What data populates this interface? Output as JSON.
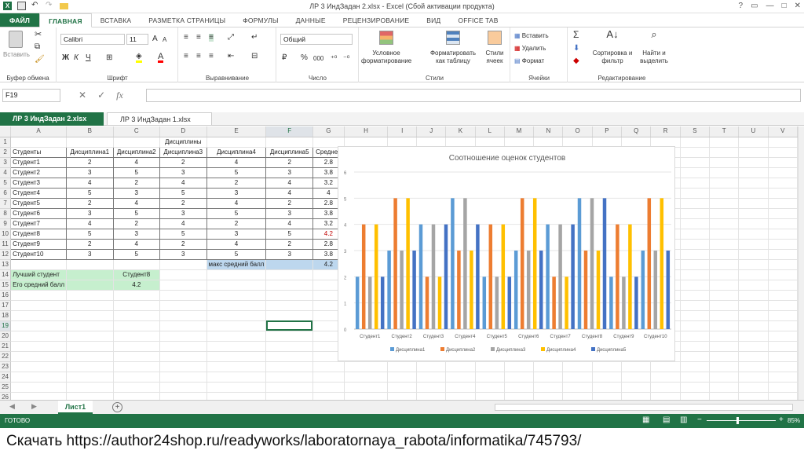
{
  "window": {
    "title": "ЛР 3 ИндЗадан 2.xlsx - Excel (Сбой активации продукта)",
    "excel_logo": "X"
  },
  "tabs": [
    "ФАЙЛ",
    "ГЛАВНАЯ",
    "ВСТАВКА",
    "РАЗМЕТКА СТРАНИЦЫ",
    "ФОРМУЛЫ",
    "ДАННЫЕ",
    "РЕЦЕНЗИРОВАНИЕ",
    "ВИД",
    "OFFICE TAB"
  ],
  "ribbon": {
    "clipboard": {
      "paste": "Вставить",
      "label": "Буфер обмена"
    },
    "font": {
      "name": "Calibri",
      "size": "11",
      "bold": "Ж",
      "italic": "К",
      "underline": "Ч",
      "label": "Шрифт",
      "grow": "A",
      "shrink": "A",
      "color_a": "A"
    },
    "align": {
      "label": "Выравнивание"
    },
    "number": {
      "format": "Общий",
      "percent": "%",
      "thousands": "000",
      "label": "Число"
    },
    "styles": {
      "conditional": "Условное форматирование",
      "format_table": "Форматировать как таблицу",
      "cell_styles": "Стили ячеек",
      "label": "Стили"
    },
    "cells": {
      "insert": "Вставить",
      "delete": "Удалить",
      "format": "Формат",
      "label": "Ячейки"
    },
    "editing": {
      "sort": "Сортировка и фильтр",
      "find": "Найти и выделить",
      "label": "Редактирование",
      "sigma": "Σ"
    }
  },
  "formula": {
    "namebox": "F19",
    "fx": "fx",
    "value": ""
  },
  "workbook_tabs": [
    {
      "label": "ЛР 3 ИндЗадан 2.xlsx",
      "active": true
    },
    {
      "label": "ЛР 3 ИндЗадан 1.xlsx",
      "active": false
    }
  ],
  "columns": [
    "A",
    "B",
    "C",
    "D",
    "E",
    "F",
    "G",
    "H",
    "I",
    "J",
    "K",
    "L",
    "M",
    "N",
    "O",
    "P",
    "Q",
    "R",
    "S",
    "T",
    "U",
    "V"
  ],
  "rows": [
    {
      "n": "1",
      "cells": [
        "",
        "",
        "",
        "Дисциплины",
        "",
        "",
        "",
        ""
      ]
    },
    {
      "n": "2",
      "cells": [
        "Студенты",
        "Дисциплина1",
        "Дисциплина2",
        "Дисциплина3",
        "Дисциплина4",
        "Дисциплина5",
        "Среднее"
      ]
    },
    {
      "n": "3",
      "cells": [
        "Студент1",
        "2",
        "4",
        "2",
        "4",
        "2",
        "2.8"
      ]
    },
    {
      "n": "4",
      "cells": [
        "Студент2",
        "3",
        "5",
        "3",
        "5",
        "3",
        "3.8"
      ]
    },
    {
      "n": "5",
      "cells": [
        "Студент3",
        "4",
        "2",
        "4",
        "2",
        "4",
        "3.2"
      ]
    },
    {
      "n": "6",
      "cells": [
        "Студент4",
        "5",
        "3",
        "5",
        "3",
        "4",
        "4"
      ]
    },
    {
      "n": "7",
      "cells": [
        "Студент5",
        "2",
        "4",
        "2",
        "4",
        "2",
        "2.8"
      ]
    },
    {
      "n": "8",
      "cells": [
        "Студент6",
        "3",
        "5",
        "3",
        "5",
        "3",
        "3.8"
      ]
    },
    {
      "n": "9",
      "cells": [
        "Студент7",
        "4",
        "2",
        "4",
        "2",
        "4",
        "3.2"
      ]
    },
    {
      "n": "10",
      "cells": [
        "Студент8",
        "5",
        "3",
        "5",
        "3",
        "5",
        "4.2"
      ]
    },
    {
      "n": "11",
      "cells": [
        "Студент9",
        "2",
        "4",
        "2",
        "4",
        "2",
        "2.8"
      ]
    },
    {
      "n": "12",
      "cells": [
        "Студент10",
        "3",
        "5",
        "3",
        "5",
        "3",
        "3.8"
      ]
    }
  ],
  "max_avg": {
    "label": "макс средний балл",
    "value": "4.2"
  },
  "best": {
    "label1": "Лучший студент",
    "value1": "Студент8",
    "label2": "Его средний балл",
    "value2": "4.2"
  },
  "row_numbers": [
    "1",
    "2",
    "3",
    "4",
    "5",
    "6",
    "7",
    "8",
    "9",
    "10",
    "11",
    "12",
    "13",
    "14",
    "15",
    "16",
    "17",
    "18",
    "19",
    "20",
    "21",
    "22",
    "23",
    "24",
    "25",
    "26"
  ],
  "sheet": {
    "name": "Лист1",
    "add": "+"
  },
  "status": {
    "ready": "ГОТОВО",
    "zoom": "85%"
  },
  "caption": "Скачать https://author24shop.ru/readyworks/laboratornaya_rabota/informatika/745793/",
  "colors": {
    "excel_green": "#217346",
    "d1": "#5b9bd5",
    "d2": "#ed7d31",
    "d3": "#a5a5a5",
    "d4": "#ffc000",
    "d5": "#4472c4"
  },
  "chart_data": {
    "type": "bar",
    "title": "Соотношение оценок студентов",
    "categories": [
      "Студент1",
      "Студент2",
      "Студент3",
      "Студент4",
      "Студент5",
      "Студент6",
      "Студент7",
      "Студент8",
      "Студент9",
      "Студент10"
    ],
    "series": [
      {
        "name": "Дисциплина1",
        "values": [
          2,
          3,
          4,
          5,
          2,
          3,
          4,
          5,
          2,
          3
        ]
      },
      {
        "name": "Дисциплина2",
        "values": [
          4,
          5,
          2,
          3,
          4,
          5,
          2,
          3,
          4,
          5
        ]
      },
      {
        "name": "Дисциплина3",
        "values": [
          2,
          3,
          4,
          5,
          2,
          3,
          4,
          5,
          2,
          3
        ]
      },
      {
        "name": "Дисциплина4",
        "values": [
          4,
          5,
          2,
          3,
          4,
          5,
          2,
          3,
          4,
          5
        ]
      },
      {
        "name": "Дисциплина5",
        "values": [
          2,
          3,
          4,
          4,
          2,
          3,
          4,
          5,
          2,
          3
        ]
      }
    ],
    "yticks": [
      "0",
      "1",
      "2",
      "3",
      "4",
      "5",
      "6"
    ],
    "ylim": [
      0,
      6
    ],
    "grid": true,
    "legend": "bottom"
  }
}
